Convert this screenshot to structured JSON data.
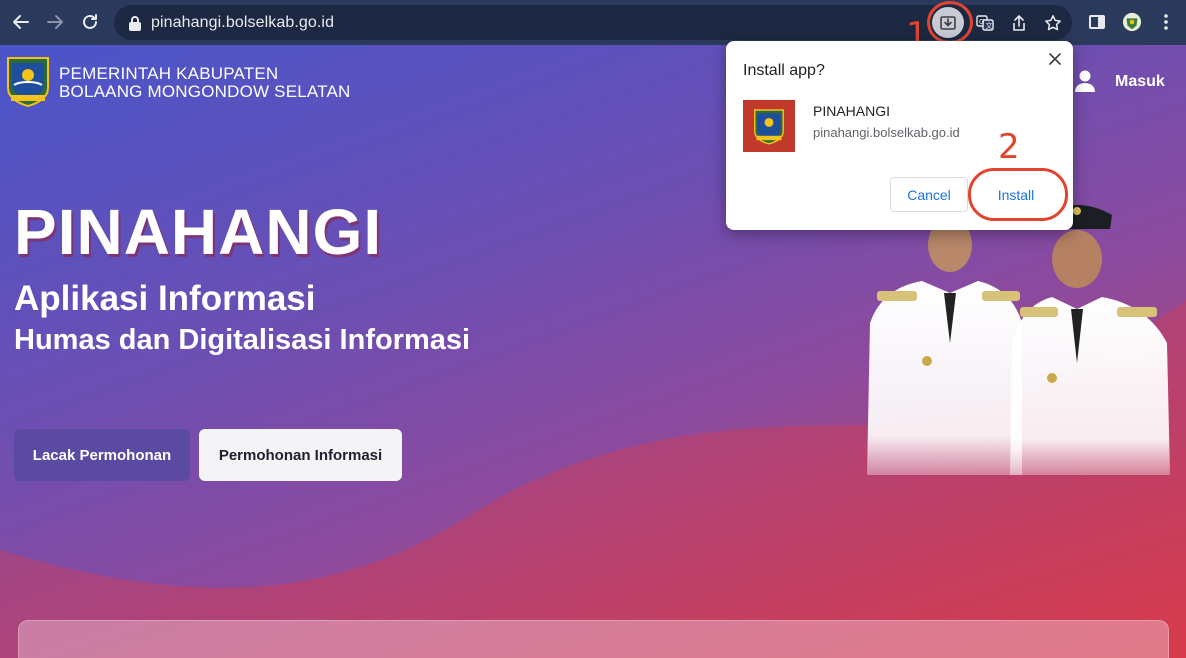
{
  "browser": {
    "url": "pinahangi.bolselkab.go.id",
    "icons": [
      "back-arrow-icon",
      "forward-arrow-icon",
      "reload-icon",
      "lock-icon",
      "install-app-icon",
      "translate-icon",
      "share-icon",
      "bookmark-star-icon",
      "side-panel-icon",
      "profile-avatar",
      "kebab-menu-icon"
    ]
  },
  "annotations": {
    "step1": "1",
    "step2": "2",
    "color": "#e2452f"
  },
  "header": {
    "brand_line1": "PEMERINTAH KABUPATEN",
    "brand_line2": "BOLAANG MONGONDOW SELATAN",
    "login_label": "Masuk"
  },
  "hero": {
    "title": "PINAHANGI",
    "subtitle1": "Aplikasi Informasi",
    "subtitle2": "Humas dan Digitalisasi Informasi",
    "btn_track": "Lacak Permohonan",
    "btn_request": "Permohonan Informasi"
  },
  "install_dialog": {
    "title": "Install app?",
    "app_name": "PINAHANGI",
    "app_url": "pinahangi.bolselkab.go.id",
    "cancel_label": "Cancel",
    "install_label": "Install"
  },
  "colors": {
    "accent": "#1a73e8",
    "toolbar": "#2b3a5c",
    "hero_gradient_start": "#4a55c9",
    "hero_gradient_end": "#c8424f"
  }
}
